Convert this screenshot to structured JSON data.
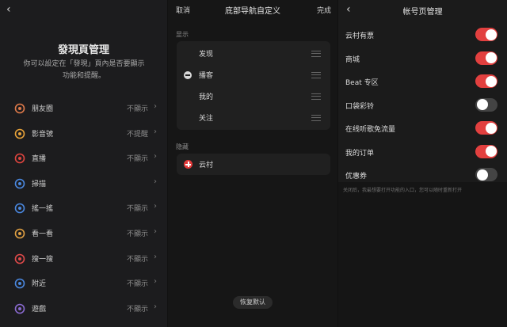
{
  "panel1": {
    "back": "‹",
    "title": "發現頁管理",
    "desc_line1": "你可以設定在「發現」頁內是否要顯示",
    "desc_line2": "功能和提醒。",
    "rows": [
      {
        "label": "朋友圈",
        "status": "不顯示",
        "icon": "moments-icon",
        "color": "#e07a4a"
      },
      {
        "label": "影音號",
        "status": "不提醒",
        "icon": "channels-icon",
        "color": "#e8a33a"
      },
      {
        "label": "直播",
        "status": "不顯示",
        "icon": "live-icon",
        "color": "#e0453f"
      },
      {
        "label": "掃描",
        "status": "",
        "icon": "scan-icon",
        "color": "#4a88e0"
      },
      {
        "label": "搖一搖",
        "status": "不顯示",
        "icon": "shake-icon",
        "color": "#4a88e0"
      },
      {
        "label": "看一看",
        "status": "不顯示",
        "icon": "top-stories-icon",
        "color": "#e0a043"
      },
      {
        "label": "搜一搜",
        "status": "不顯示",
        "icon": "search-icon",
        "color": "#e04a4a"
      },
      {
        "label": "附近",
        "status": "不顯示",
        "icon": "nearby-icon",
        "color": "#4a88e0"
      },
      {
        "label": "遊戲",
        "status": "不顯示",
        "icon": "games-icon",
        "color": "#8a6ad0"
      }
    ]
  },
  "panel2": {
    "cancel": "取消",
    "title": "底部导航自定义",
    "done": "完成",
    "shown_label": "显示",
    "shown_items": [
      {
        "label": "发现",
        "removable": false
      },
      {
        "label": "播客",
        "removable": true
      },
      {
        "label": "我的",
        "removable": false
      },
      {
        "label": "关注",
        "removable": false
      }
    ],
    "hidden_label": "隐藏",
    "hidden_items": [
      {
        "label": "云村"
      }
    ],
    "restore": "恢复默认"
  },
  "panel3": {
    "back": "‹",
    "title": "帐号页管理",
    "rows": [
      {
        "label": "云村有票",
        "on": true
      },
      {
        "label": "商城",
        "on": true
      },
      {
        "label": "Beat 专区",
        "on": true
      },
      {
        "label": "口袋彩铃",
        "on": false
      },
      {
        "label": "在线听歌免流量",
        "on": true
      },
      {
        "label": "我的订单",
        "on": true
      },
      {
        "label": "优惠券",
        "on": false
      }
    ],
    "note": "关闭后，我最想要打开功能的入口，您可以随时重新打开"
  },
  "colors": {
    "accent": "#e2403f"
  }
}
